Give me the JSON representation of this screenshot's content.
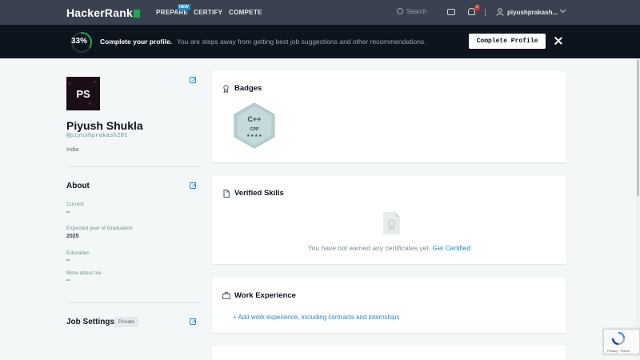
{
  "nav": {
    "logo": "HackerRank",
    "items": [
      "PREPARE",
      "CERTIFY",
      "COMPETE"
    ],
    "new_badge": "NEW",
    "search_placeholder": "Search",
    "notification_count": "2",
    "username": "piyushprakash..."
  },
  "banner": {
    "percent": "33%",
    "progress_value": 0.33,
    "title": "Complete your profile.",
    "text": "You are steps away from getting best job suggestions and other recommendations.",
    "button": "Complete Profile"
  },
  "profile": {
    "initials": "PS",
    "name": "Piyush Shukla",
    "handle": "@piyushprakash201",
    "country": "India"
  },
  "about": {
    "title": "About",
    "fields": [
      {
        "label": "Current",
        "value": "--"
      },
      {
        "label": "Expected year of Graduation",
        "value": "2025"
      },
      {
        "label": "Education",
        "value": "--"
      },
      {
        "label": "More about me",
        "value": "--"
      }
    ]
  },
  "job_settings": {
    "title": "Job Settings",
    "visibility": "Private"
  },
  "badges": {
    "title": "Badges",
    "items": [
      {
        "title": "C++",
        "name": "CPP",
        "stars": "★★★★"
      }
    ]
  },
  "skills": {
    "title": "Verified Skills",
    "empty_text": "You have not earned any certificates yet.",
    "link": "Get Certified"
  },
  "work": {
    "title": "Work Experience",
    "add_link": "+ Add work experience, including contracts and internships"
  },
  "recaptcha": {
    "text": "Privacy - Terms"
  },
  "colors": {
    "nav_bg": "#39424e",
    "banner_bg": "#0e141e",
    "accent_green": "#1ba94c",
    "link_blue": "#1f8acb"
  }
}
